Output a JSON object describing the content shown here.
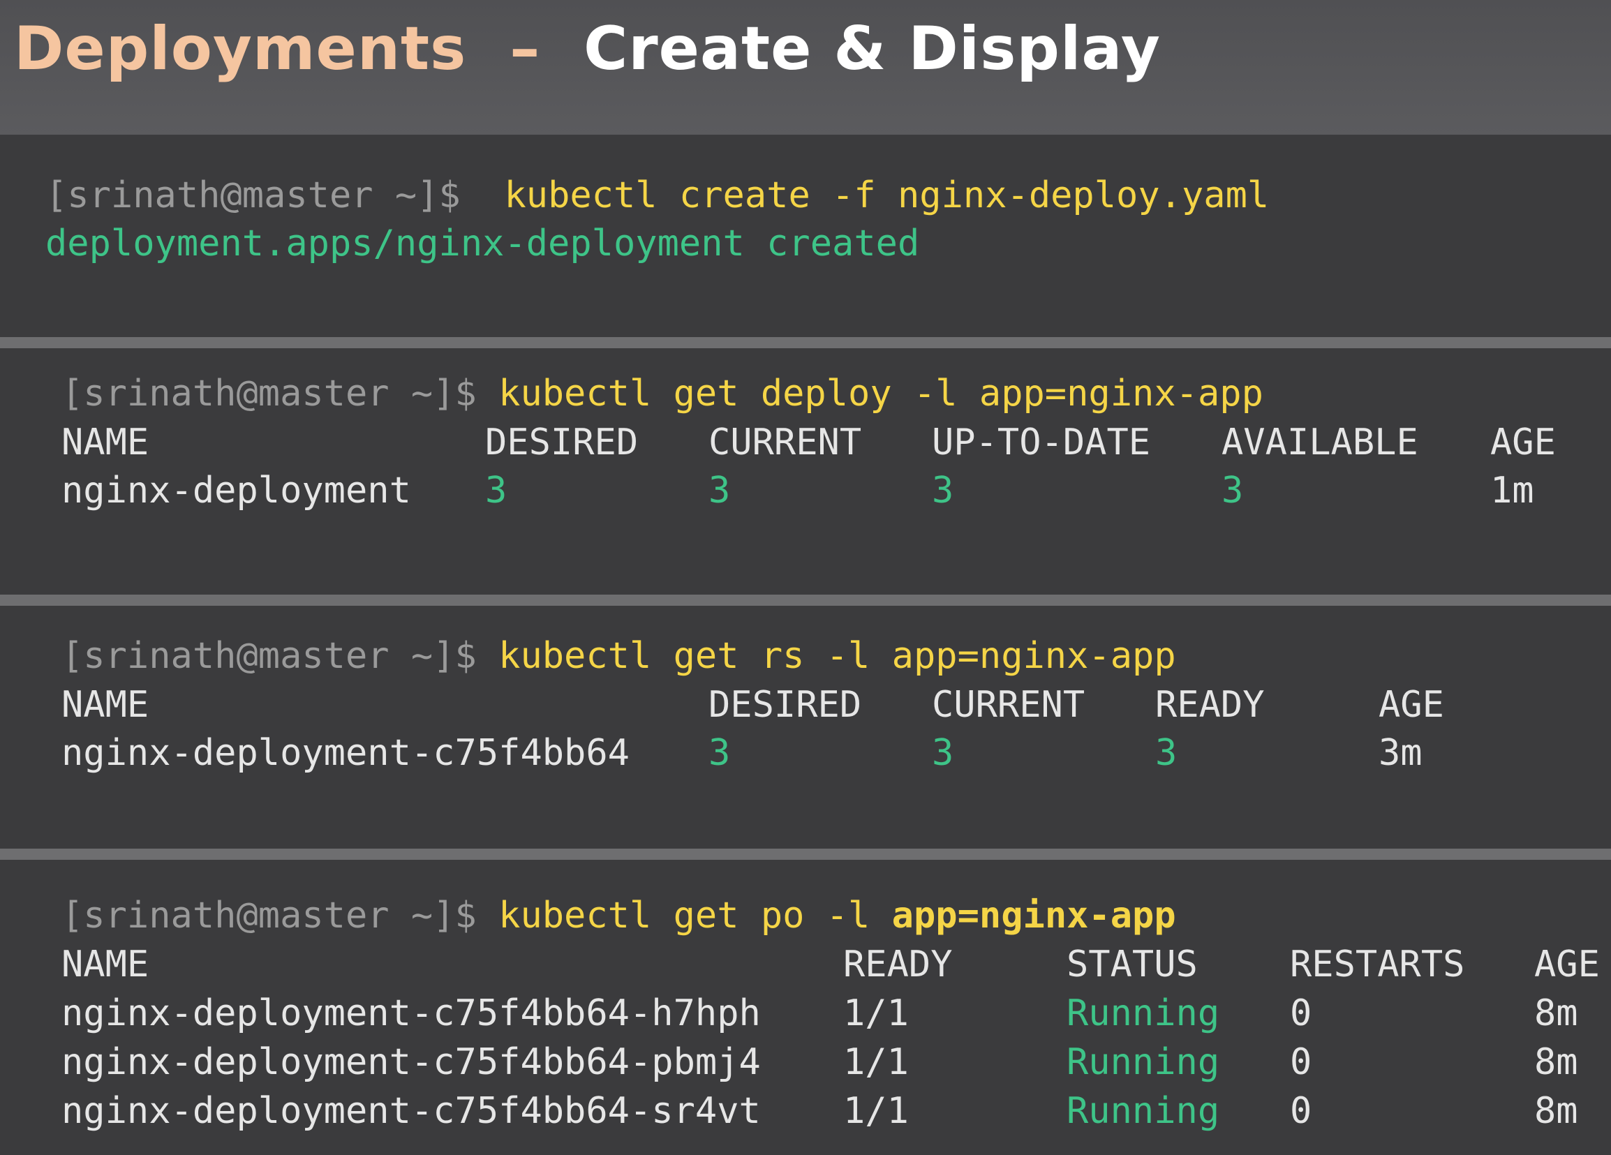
{
  "header": {
    "title_accent": "Deployments",
    "title_sep": "–",
    "title_main": "Create & Display"
  },
  "prompt": "[srinath@master ~]$",
  "block1": {
    "command": "kubectl create -f nginx-deploy.yaml",
    "output": "deployment.apps/nginx-deployment created"
  },
  "block2": {
    "command": "kubectl get deploy -l app=nginx-app",
    "headers": [
      "NAME",
      "DESIRED",
      "CURRENT",
      "UP-TO-DATE",
      "AVAILABLE",
      "AGE"
    ],
    "rows": [
      [
        "nginx-deployment",
        "3",
        "3",
        "3",
        "3",
        "1m"
      ]
    ]
  },
  "block3": {
    "command": "kubectl get rs -l app=nginx-app",
    "headers": [
      "NAME",
      "DESIRED",
      "CURRENT",
      "READY",
      "AGE"
    ],
    "rows": [
      [
        "nginx-deployment-c75f4bb64",
        "3",
        "3",
        "3",
        "3m"
      ]
    ]
  },
  "block4": {
    "command_prefix": "kubectl get po -l ",
    "command_arg": "app=nginx-app",
    "headers": [
      "NAME",
      "READY",
      "STATUS",
      "RESTARTS",
      "AGE"
    ],
    "rows": [
      [
        "nginx-deployment-c75f4bb64-h7hph",
        "1/1",
        "Running",
        "0",
        "8m"
      ],
      [
        "nginx-deployment-c75f4bb64-pbmj4",
        "1/1",
        "Running",
        "0",
        "8m"
      ],
      [
        "nginx-deployment-c75f4bb64-sr4vt",
        "1/1",
        "Running",
        "0",
        "8m"
      ]
    ]
  },
  "colors": {
    "prompt": "#9a9a9a",
    "command": "#f5d547",
    "success": "#3ec488",
    "text": "#e6e6e6",
    "title_accent": "#f5c5a0"
  }
}
